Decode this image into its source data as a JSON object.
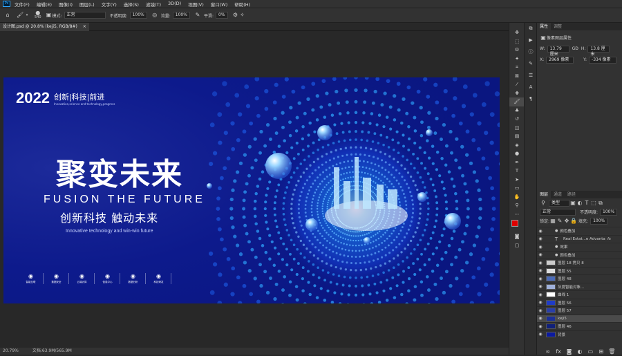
{
  "menu": [
    "文件(F)",
    "编辑(E)",
    "图像(I)",
    "图层(L)",
    "文字(Y)",
    "选择(S)",
    "滤镜(T)",
    "3D(D)",
    "视图(V)",
    "窗口(W)",
    "帮助(H)"
  ],
  "options": {
    "brush_size": "540",
    "mode_label": "模式:",
    "mode_value": "正常",
    "opacity_label": "不透明度:",
    "opacity_value": "100%",
    "flow_label": "流量:",
    "flow_value": "100%",
    "smooth_label": "平滑:",
    "smooth_value": "0%"
  },
  "document_tab": "设计图.psd @ 20.8% (keji5, RGB/8#)",
  "document_tab_close": "×",
  "status": {
    "zoom": "20.79%",
    "doc": "文档:63.9M/565.9M"
  },
  "artwork": {
    "year": "2022",
    "tagline": "创新|科技|前进",
    "tagline_en": "Innovation,science and technology,progress",
    "headline_cn": "聚变未来",
    "headline_en": "FUSION THE FUTURE",
    "sub_cn": "创新科技 触动未来",
    "sub_en": "Innovative technology and win-win future",
    "icons": [
      "智能互联",
      "数据安全",
      "云端计算",
      "信息中心",
      "数据分析",
      "科技研发"
    ]
  },
  "properties": {
    "tabs": [
      "属性",
      "调整"
    ],
    "section": "像素图层属性",
    "w_label": "W:",
    "w_value": "13.79 厘米",
    "link": "GĐ",
    "h_label": "H:",
    "h_value": "13.8 厘米",
    "x_label": "X:",
    "x_value": "2969 像素",
    "y_label": "Y:",
    "y_value": "-334 像素"
  },
  "layers_panel": {
    "tabs": [
      "图层",
      "通道",
      "路径"
    ],
    "filter": "类型",
    "blend": "正常",
    "opacity_label": "不透明度:",
    "opacity_value": "100%",
    "lock_label": "锁定:",
    "fill_label": "填充:",
    "fill_value": "100%",
    "layers": [
      {
        "name": "颜色叠加",
        "indent": 2,
        "eye": true
      },
      {
        "name": "Real Estat...e Advanta",
        "indent": 1,
        "eye": true,
        "type": "text",
        "fx": "fx"
      },
      {
        "name": "效果",
        "indent": 2,
        "eye": true
      },
      {
        "name": "颜色叠加",
        "indent": 2,
        "eye": true
      },
      {
        "name": "图层 18 拷贝 8",
        "indent": 0,
        "eye": true,
        "thumb": "#cccccc"
      },
      {
        "name": "图层 55",
        "indent": 0,
        "eye": true,
        "thumb": "#dddddd"
      },
      {
        "name": "图层 48",
        "indent": 0,
        "eye": true,
        "thumb": "#4a6ab8"
      },
      {
        "name": "灰度智能对象...",
        "indent": 0,
        "eye": true,
        "thumb": "#9fb0d9"
      },
      {
        "name": "曲线 1",
        "indent": 0,
        "eye": true,
        "thumb": "#ffffff"
      },
      {
        "name": "图层 56",
        "indent": 0,
        "eye": true,
        "thumb": "#1f3cc8"
      },
      {
        "name": "图层 57",
        "indent": 0,
        "eye": true,
        "thumb": "#2a3fa8"
      },
      {
        "name": "keji5",
        "indent": 0,
        "eye": true,
        "thumb": "#1b2f96",
        "selected": true
      },
      {
        "name": "图层 46",
        "indent": 0,
        "eye": true,
        "thumb": "#10207a"
      },
      {
        "name": "背景",
        "indent": 0,
        "eye": true,
        "thumb": "#0b1aa0"
      }
    ]
  },
  "colors": {
    "foreground": "#e00000",
    "background": "#ffffff",
    "selected_row": "#4b4b4b"
  }
}
